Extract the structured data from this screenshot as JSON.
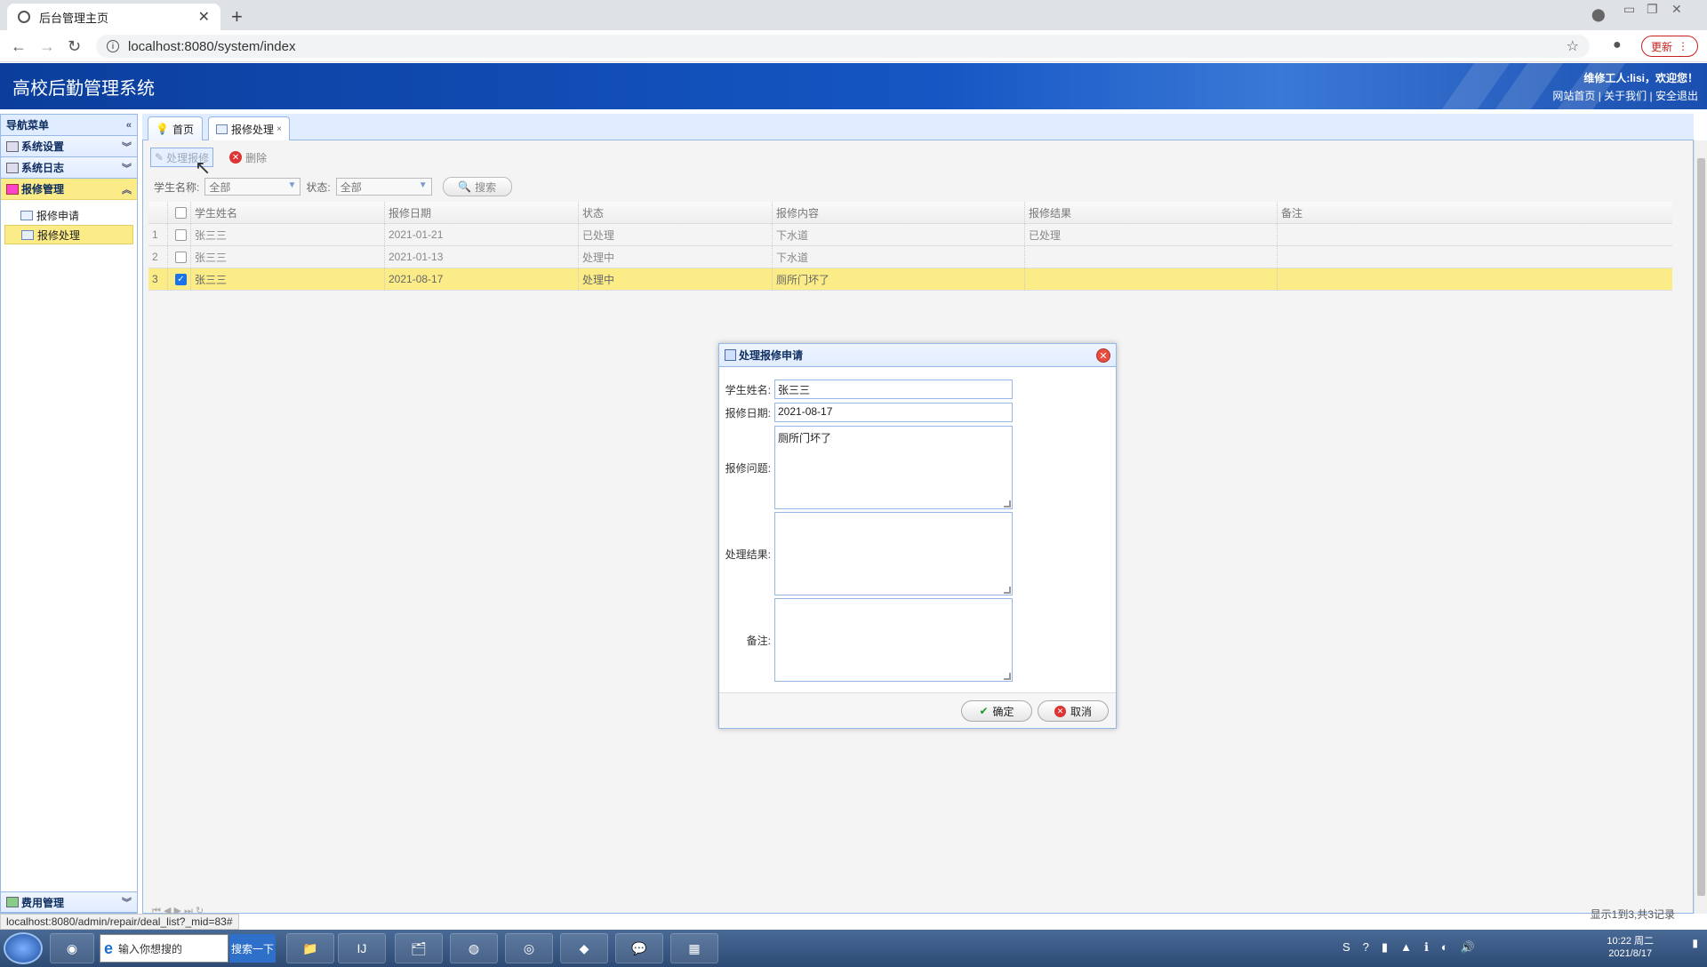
{
  "browser": {
    "tab_title": "后台管理主页",
    "url": "localhost:8080/system/index",
    "update_label": "更新"
  },
  "header": {
    "title": "高校后勤管理系统",
    "welcome": "维修工人:lisi，欢迎您！",
    "links": [
      "网站首页",
      "关于我们",
      "安全退出"
    ]
  },
  "sidebar": {
    "title": "导航菜单",
    "sections": [
      {
        "label": "系统设置"
      },
      {
        "label": "系统日志"
      },
      {
        "label": "报修管理",
        "items": [
          "报修申请",
          "报修处理"
        ]
      }
    ],
    "bottom_section": "费用管理"
  },
  "tabs": [
    {
      "label": "首页"
    },
    {
      "label": "报修处理"
    }
  ],
  "toolbar": {
    "process_label": "处理报修",
    "delete_label": "删除"
  },
  "filters": {
    "student_label": "学生名称:",
    "student_value": "全部",
    "status_label": "状态:",
    "status_value": "全部",
    "search_label": "搜索"
  },
  "grid": {
    "columns": [
      "学生姓名",
      "报修日期",
      "状态",
      "报修内容",
      "报修结果",
      "备注"
    ],
    "rows": [
      {
        "num": "1",
        "name": "张三三",
        "date": "2021-01-21",
        "status": "已处理",
        "content": "下水道",
        "result": "已处理",
        "note": ""
      },
      {
        "num": "2",
        "name": "张三三",
        "date": "2021-01-13",
        "status": "处理中",
        "content": "下水道",
        "result": "",
        "note": ""
      },
      {
        "num": "3",
        "name": "张三三",
        "date": "2021-08-17",
        "status": "处理中",
        "content": "厕所门坏了",
        "result": "",
        "note": ""
      }
    ],
    "page_info": "显示1到3,共3记录"
  },
  "dialog": {
    "title": "处理报修申请",
    "fields": {
      "student_name_label": "学生姓名:",
      "student_name": "张三三",
      "date_label": "报修日期:",
      "date": "2021-08-17",
      "problem_label": "报修问题:",
      "problem": "厕所门坏了",
      "result_label": "处理结果:",
      "result": "",
      "note_label": "备注:",
      "note": ""
    },
    "ok_label": "确定",
    "cancel_label": "取消"
  },
  "status_url": "localhost:8080/admin/repair/deal_list?_mid=83#",
  "taskbar": {
    "search_placeholder": "输入你想搜的",
    "search_button": "搜索一下",
    "clock_time": "10:22 周二",
    "clock_date": "2021/8/17"
  }
}
